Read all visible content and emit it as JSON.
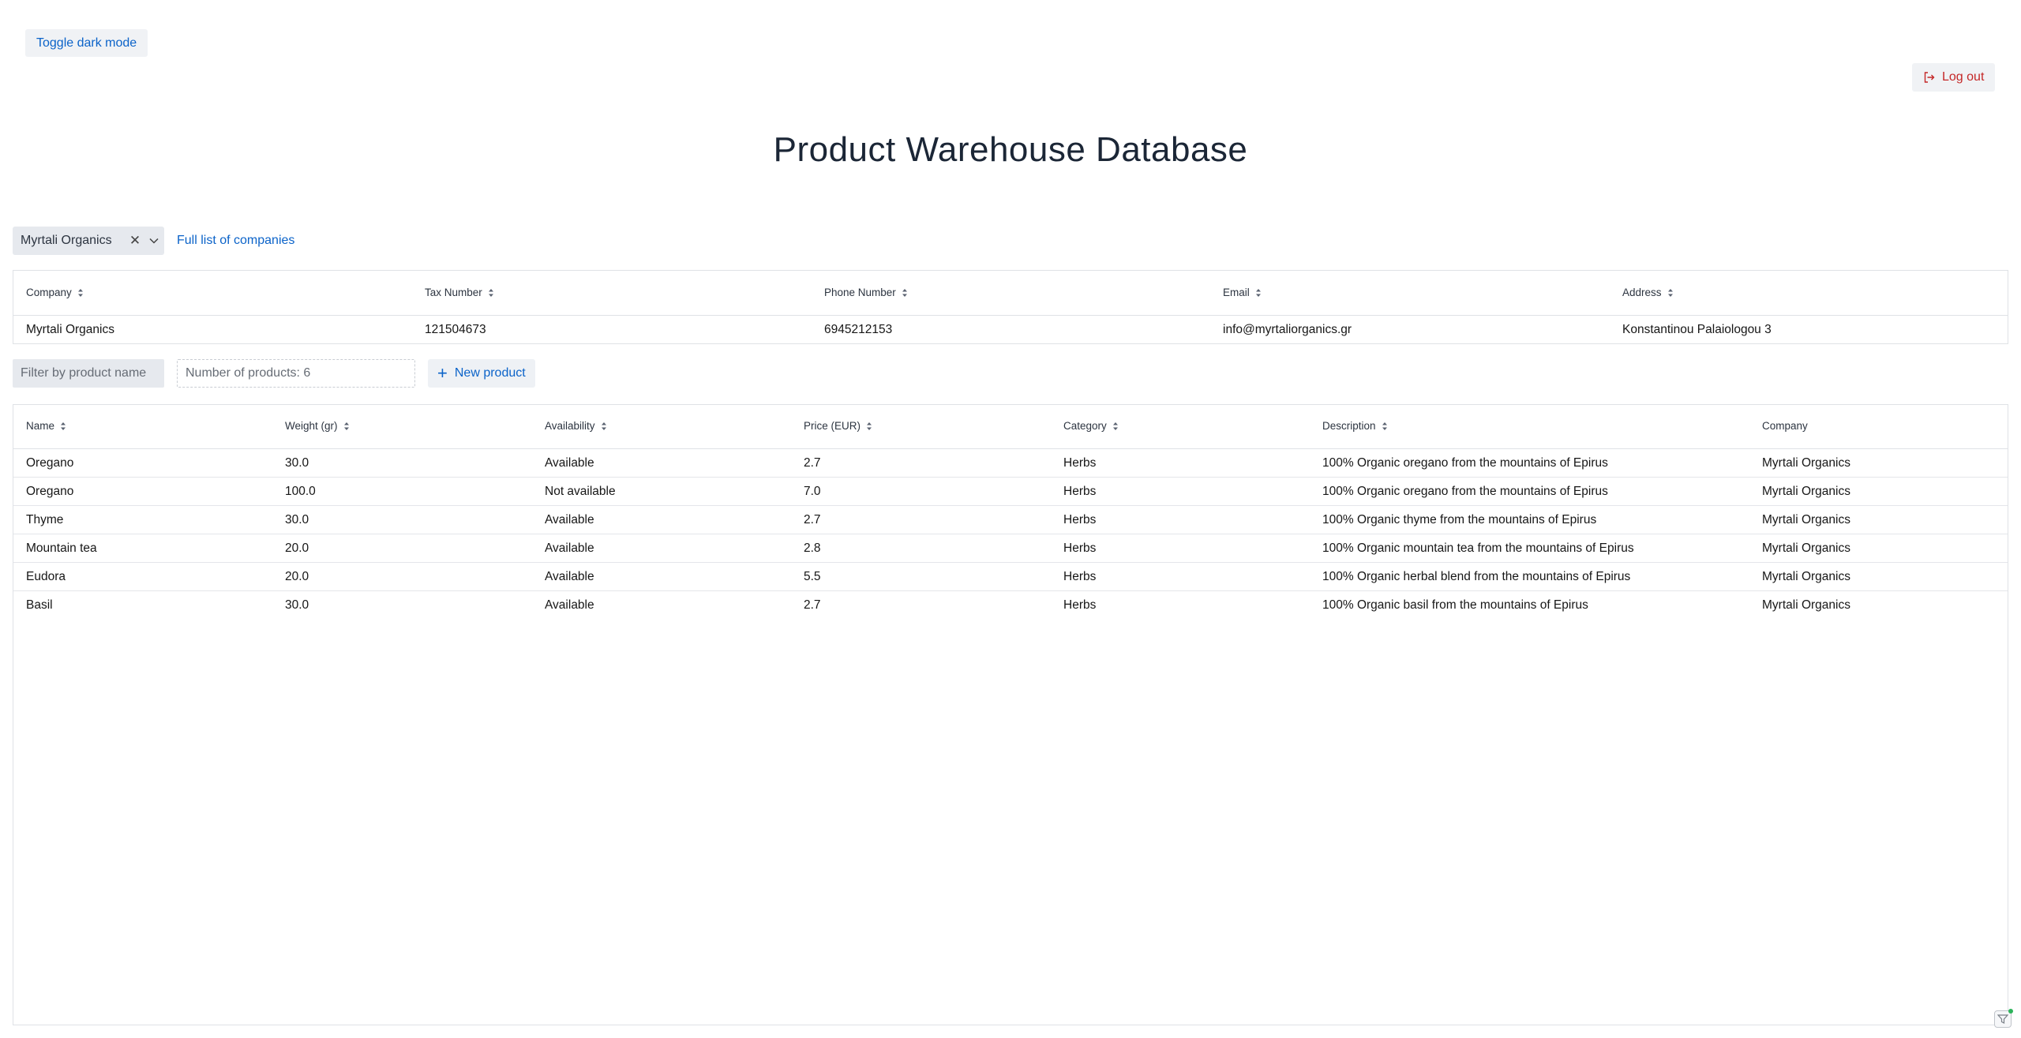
{
  "header": {
    "dark_toggle_label": "Toggle dark mode",
    "logout_label": "Log out",
    "title": "Product Warehouse Database"
  },
  "company_selector": {
    "selected": "Myrtali Organics",
    "full_list_link": "Full list of companies"
  },
  "company_table": {
    "columns": [
      "Company",
      "Tax Number",
      "Phone Number",
      "Email",
      "Address"
    ],
    "rows": [
      [
        "Myrtali Organics",
        "121504673",
        "6945212153",
        "info@myrtaliorganics.gr",
        "Konstantinou Palaiologou 3"
      ]
    ]
  },
  "product_toolbar": {
    "filter_placeholder": "Filter by product name",
    "count_text": "Number of products: 6",
    "new_product_label": "New product"
  },
  "product_table": {
    "columns": [
      "Name",
      "Weight (gr)",
      "Availability",
      "Price (EUR)",
      "Category",
      "Description",
      "Company"
    ],
    "rows": [
      [
        "Oregano",
        "30.0",
        "Available",
        "2.7",
        "Herbs",
        "100% Organic oregano from the mountains of Epirus",
        "Myrtali Organics"
      ],
      [
        "Oregano",
        "100.0",
        "Not available",
        "7.0",
        "Herbs",
        "100% Organic oregano from the mountains of Epirus",
        "Myrtali Organics"
      ],
      [
        "Thyme",
        "30.0",
        "Available",
        "2.7",
        "Herbs",
        "100% Organic thyme from the mountains of Epirus",
        "Myrtali Organics"
      ],
      [
        "Mountain tea",
        "20.0",
        "Available",
        "2.8",
        "Herbs",
        "100% Organic mountain tea from the mountains of Epirus",
        "Myrtali Organics"
      ],
      [
        "Eudora",
        "20.0",
        "Available",
        "5.5",
        "Herbs",
        "100% Organic herbal blend from the mountains of Epirus",
        "Myrtali Organics"
      ],
      [
        "Basil",
        "30.0",
        "Available",
        "2.7",
        "Herbs",
        "100% Organic basil from the mountains of Epirus",
        "Myrtali Organics"
      ]
    ]
  },
  "icons": {
    "logout": "logout-icon",
    "clear": "close-icon",
    "dropdown": "chevron-down-icon",
    "sort": "sort-icon",
    "add": "plus-icon",
    "corner": "filter-icon"
  },
  "colors": {
    "link": "#0b63c9",
    "logout": "#c42727",
    "title": "#1b2636"
  }
}
